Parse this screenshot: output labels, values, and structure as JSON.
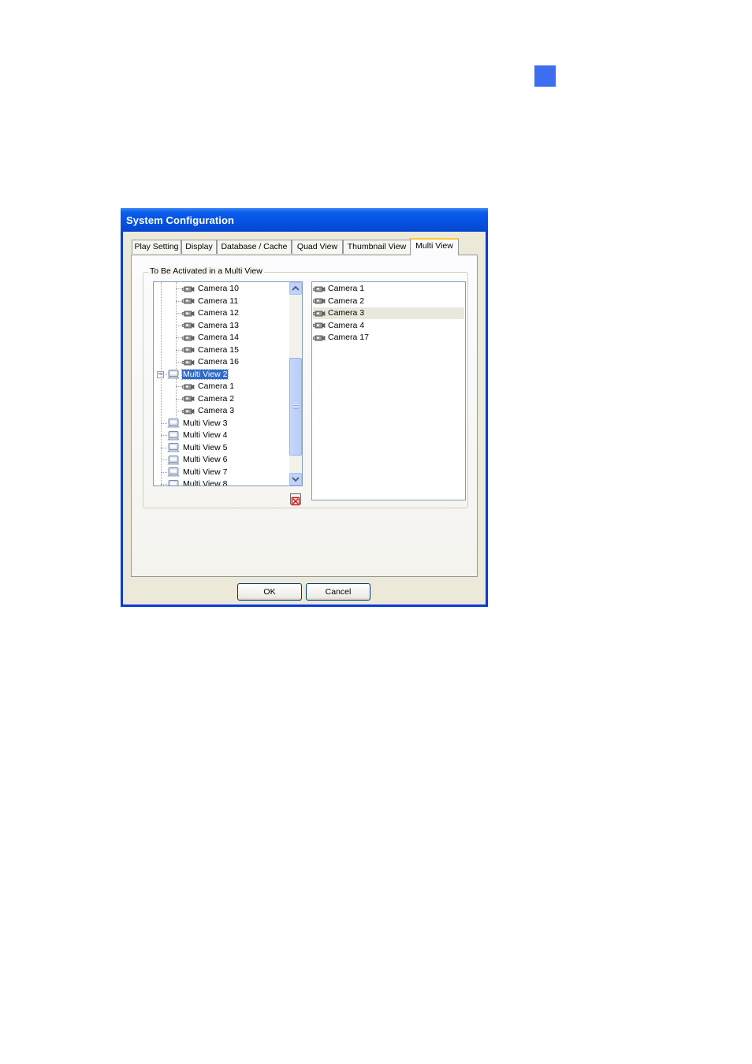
{
  "window": {
    "title": "System Configuration"
  },
  "tabs": [
    {
      "label": "Play Setting"
    },
    {
      "label": "Display"
    },
    {
      "label": "Database / Cache"
    },
    {
      "label": "Quad View"
    },
    {
      "label": "Thumbnail View"
    },
    {
      "label": "Multi View",
      "active": true
    }
  ],
  "group": {
    "legend": "To Be Activated in a Multi View"
  },
  "tree": {
    "items": [
      {
        "label": "Camera 10",
        "type": "camera"
      },
      {
        "label": "Camera 11",
        "type": "camera"
      },
      {
        "label": "Camera 12",
        "type": "camera"
      },
      {
        "label": "Camera 13",
        "type": "camera"
      },
      {
        "label": "Camera 14",
        "type": "camera"
      },
      {
        "label": "Camera 15",
        "type": "camera"
      },
      {
        "label": "Camera 16",
        "type": "camera"
      },
      {
        "label": "Multi View 2",
        "type": "multiview",
        "expanded": true,
        "selected": true
      },
      {
        "label": "Camera 1",
        "type": "camera"
      },
      {
        "label": "Camera 2",
        "type": "camera"
      },
      {
        "label": "Camera 3",
        "type": "camera"
      },
      {
        "label": "Multi View 3",
        "type": "multiview"
      },
      {
        "label": "Multi View 4",
        "type": "multiview"
      },
      {
        "label": "Multi View 5",
        "type": "multiview"
      },
      {
        "label": "Multi View 6",
        "type": "multiview"
      },
      {
        "label": "Multi View 7",
        "type": "multiview"
      },
      {
        "label": "Multi View 8",
        "type": "multiview"
      }
    ]
  },
  "activated_list": [
    {
      "label": "Camera 1"
    },
    {
      "label": "Camera 2"
    },
    {
      "label": "Camera 3",
      "highlighted": true
    },
    {
      "label": "Camera 4"
    },
    {
      "label": "Camera 17"
    }
  ],
  "buttons": {
    "ok": "OK",
    "cancel": "Cancel"
  },
  "colors": {
    "accent_square": "#3d6ef0",
    "selection": "#316ac5",
    "title_bar": "#0a5ded"
  },
  "icons": {
    "camera": "camera-icon",
    "multiview": "multi-view-icon",
    "delete": "delete-icon"
  }
}
